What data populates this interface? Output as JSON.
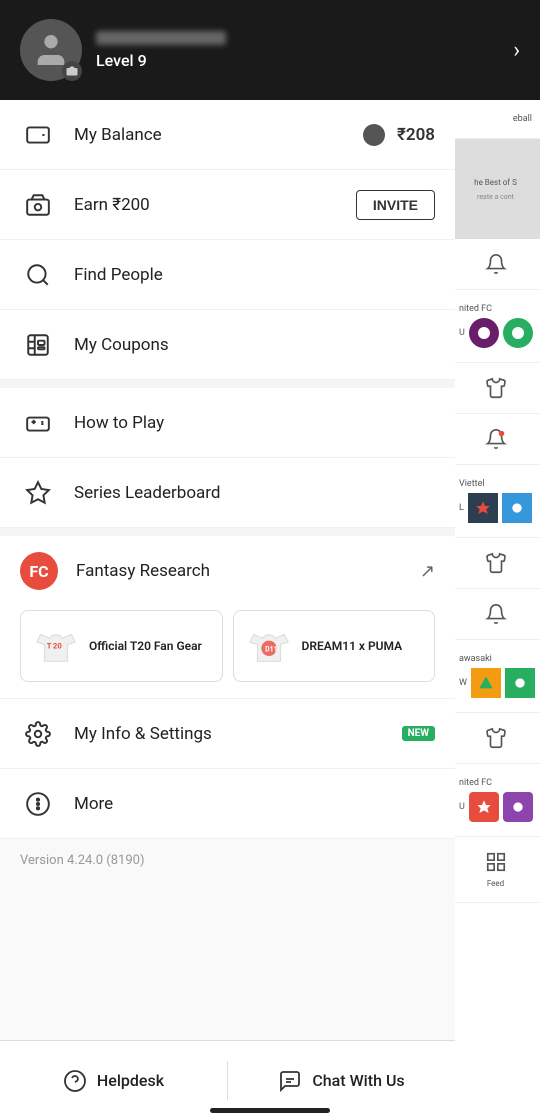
{
  "header": {
    "level": "Level 9",
    "arrow": "›"
  },
  "menu": {
    "balance_label": "My Balance",
    "balance_value": "₹208",
    "earn_label": "Earn ₹200",
    "earn_invite": "INVITE",
    "find_people": "Find People",
    "my_coupons": "My Coupons",
    "how_to_play": "How to Play",
    "series_leaderboard": "Series Leaderboard",
    "fantasy_research": "Fantasy Research",
    "my_info": "My Info & Settings",
    "new_badge": "NEW",
    "more": "More",
    "version": "Version 4.24.0 (8190)"
  },
  "merch": [
    {
      "brand": "T20",
      "label": "Official T20 Fan Gear"
    },
    {
      "brand": "D11",
      "label": "DREAM11\nx PUMA"
    }
  ],
  "bottom": {
    "helpdesk": "Helpdesk",
    "chat": "Chat With Us"
  },
  "right_col": {
    "label1": "eball",
    "label2": "he Best of S",
    "label3": "reate a cont",
    "team1": "nited FC",
    "team2": "U",
    "label4": "Viettel",
    "team3": "L",
    "label5": "awasaki",
    "team4": "W",
    "label6": "nited FC",
    "team5": "U",
    "feed": "Feed"
  }
}
